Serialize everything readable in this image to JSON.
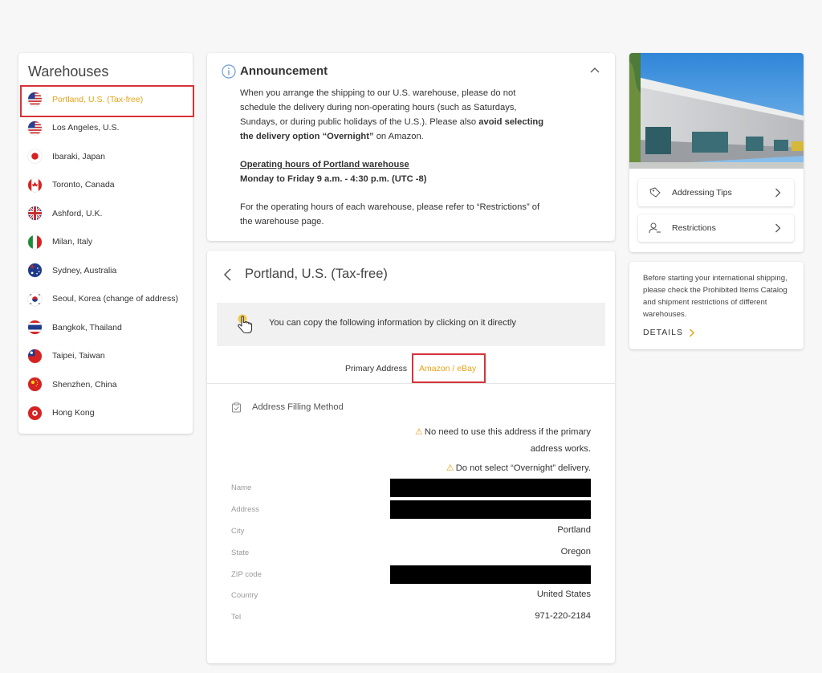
{
  "sidebar": {
    "title": "Warehouses",
    "items": [
      {
        "label": "Portland, U.S. (Tax-free)",
        "flag": "us",
        "active": true
      },
      {
        "label": "Los Angeles, U.S.",
        "flag": "us"
      },
      {
        "label": "Ibaraki, Japan",
        "flag": "jp"
      },
      {
        "label": "Toronto, Canada",
        "flag": "ca"
      },
      {
        "label": "Ashford, U.K.",
        "flag": "uk"
      },
      {
        "label": "Milan, Italy",
        "flag": "it"
      },
      {
        "label": "Sydney, Australia",
        "flag": "au"
      },
      {
        "label": "Seoul, Korea (change of address)",
        "flag": "kr"
      },
      {
        "label": "Bangkok, Thailand",
        "flag": "th"
      },
      {
        "label": "Taipei, Taiwan",
        "flag": "tw"
      },
      {
        "label": "Shenzhen, China",
        "flag": "cn"
      },
      {
        "label": "Hong Kong",
        "flag": "hk"
      }
    ]
  },
  "announcement": {
    "title": "Announcement",
    "p1_a": "When you arrange the shipping to our U.S. warehouse, please do not schedule the delivery during non-operating hours (such as Saturdays, Sundays, or during public holidays of the U.S.). Please also ",
    "p1_bold": "avoid selecting the delivery option “Overnight”",
    "p1_c": " on Amazon.",
    "hours_title": "Operating hours of Portland warehouse",
    "hours_value": "Monday to Friday 9 a.m. - 4:30 p.m. (UTC -8)",
    "p3": "For the operating hours of each warehouse, please refer to “Restrictions” of the warehouse page."
  },
  "warehouse": {
    "title": "Portland, U.S. (Tax-free)",
    "copy_hint": "You can copy the following information by clicking on it directly",
    "tabs": {
      "primary": "Primary Address",
      "amazon": "Amazon / eBay"
    },
    "method_label": "Address Filling Method",
    "note1": "No need to use this address if the primary address works.",
    "note2": "Do not select “Overnight” delivery.",
    "fields": {
      "name": {
        "label": "Name"
      },
      "address": {
        "label": "Address"
      },
      "city": {
        "label": "City",
        "value": "Portland"
      },
      "state": {
        "label": "State",
        "value": "Oregon"
      },
      "zip": {
        "label": "ZIP code"
      },
      "country": {
        "label": "Country",
        "value": "United States"
      },
      "tel": {
        "label": "Tel",
        "value": "971-220-2184"
      }
    }
  },
  "side": {
    "tips_label": "Addressing Tips",
    "restrictions_label": "Restrictions",
    "info_text": "Before starting your international shipping, please check the Prohibited Items Catalog and shipment restrictions of different warehouses.",
    "details_label": "DETAILS"
  },
  "colors": {
    "accent": "#e8a317",
    "highlight_box": "#d6333a"
  }
}
